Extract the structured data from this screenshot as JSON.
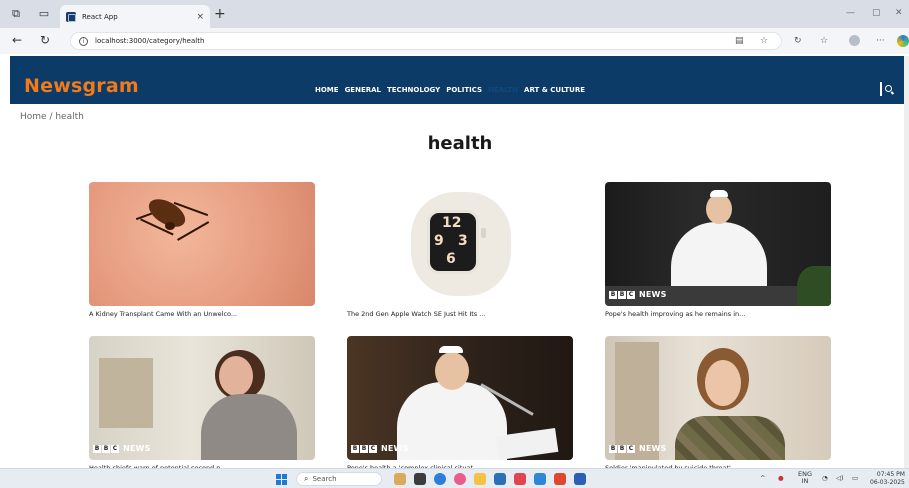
{
  "browser": {
    "tab_title": "React App",
    "tab_close": "×",
    "new_tab": "+",
    "url": "localhost:3000/category/health",
    "info_icon": "i",
    "window_controls": [
      "—",
      "▢",
      "✕"
    ]
  },
  "site": {
    "logo": "Newsgram",
    "nav": [
      "HOME",
      "GENERAL",
      "TECHNOLOGY",
      "POLITICS",
      "HEALTH",
      "ART & CULTURE"
    ],
    "active_nav": "HEALTH"
  },
  "breadcrumb": "Home / health",
  "page_title": "health",
  "bbc_badge": {
    "b1": "B",
    "b2": "B",
    "b3": "C",
    "news": "NEWS"
  },
  "articles": [
    {
      "title": "A Kidney Transplant Came With an Unwelco...",
      "image": "tick-on-skin",
      "bbc": false
    },
    {
      "title": "The 2nd Gen Apple Watch SE Just Hit Its ...",
      "image": "apple-watch",
      "bbc": false
    },
    {
      "title": "Pope's health improving as he remains in...",
      "image": "pope-balcony",
      "bbc": true
    },
    {
      "title": "Health chiefs warn of potential second p...",
      "image": "woman-coughing",
      "bbc": true
    },
    {
      "title": "Pope's health a 'complex clinical situat...",
      "image": "pope-speaking",
      "bbc": true
    },
    {
      "title": "Soldier 'manipulated by suicide threat'",
      "image": "soldier-portrait",
      "bbc": true
    }
  ],
  "taskbar": {
    "search_label": "Search",
    "lang_top": "ENG",
    "lang_bottom": "IN",
    "time": "07:45 PM",
    "date": "06-03-2025"
  },
  "colors": {
    "header_bg": "#0b3b66",
    "logo": "#f27a1a",
    "nav_text": "#ffffff",
    "nav_active": "#0e4a7f"
  }
}
